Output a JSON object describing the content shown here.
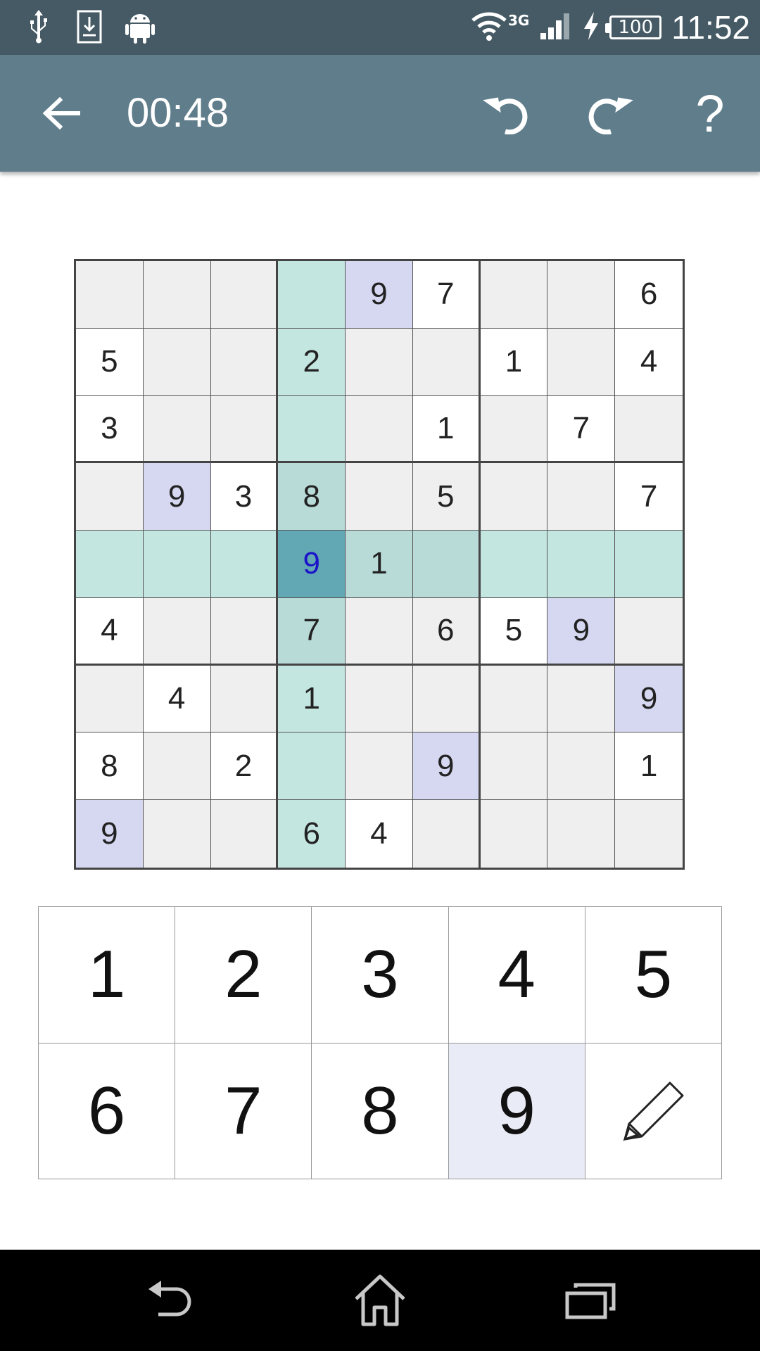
{
  "status_bar": {
    "time": "11:52",
    "network": "3G",
    "battery": "100",
    "icons": [
      "usb-icon",
      "download-icon",
      "android-icon",
      "wifi-icon",
      "signal-icon",
      "charging-icon",
      "battery-icon"
    ]
  },
  "app_bar": {
    "timer": "00:48",
    "help_label": "?",
    "icons": [
      "back-arrow-icon",
      "undo-icon",
      "redo-icon",
      "help-icon"
    ]
  },
  "board": {
    "rows": [
      [
        "",
        "",
        "",
        "",
        "9",
        "7",
        "",
        "",
        "6"
      ],
      [
        "5",
        "",
        "",
        "2",
        "",
        "",
        "1",
        "",
        "4"
      ],
      [
        "3",
        "",
        "",
        "",
        "",
        "1",
        "",
        "7",
        ""
      ],
      [
        "",
        "9",
        "3",
        "8",
        "",
        "5",
        "",
        "",
        "7"
      ],
      [
        "",
        "",
        "",
        "9",
        "1",
        "",
        "",
        "",
        ""
      ],
      [
        "4",
        "",
        "",
        "7",
        "",
        "6",
        "5",
        "9",
        ""
      ],
      [
        "",
        "4",
        "",
        "1",
        "",
        "",
        "",
        "",
        "9"
      ],
      [
        "8",
        "",
        "2",
        "",
        "",
        "9",
        "",
        "",
        "1"
      ],
      [
        "9",
        "",
        "",
        "6",
        "4",
        "",
        "",
        "",
        ""
      ]
    ],
    "selected_cell": {
      "row": 5,
      "col": 4
    },
    "colors": {
      "given": "#efefef",
      "empty": "#ffffff",
      "highlight_line": "#c4e6e1",
      "highlight_box": "#b8dbd7",
      "same_digit": "#d5d8f0",
      "selected": "#62a7b4",
      "selected_text": "#1b12c9"
    }
  },
  "numpad": {
    "keys": [
      "1",
      "2",
      "3",
      "4",
      "5",
      "6",
      "7",
      "8",
      "9"
    ],
    "active_key": "9",
    "pencil_icon": "pencil-icon"
  },
  "nav_bar": {
    "icons": [
      "nav-back-icon",
      "nav-home-icon",
      "nav-recents-icon"
    ]
  }
}
